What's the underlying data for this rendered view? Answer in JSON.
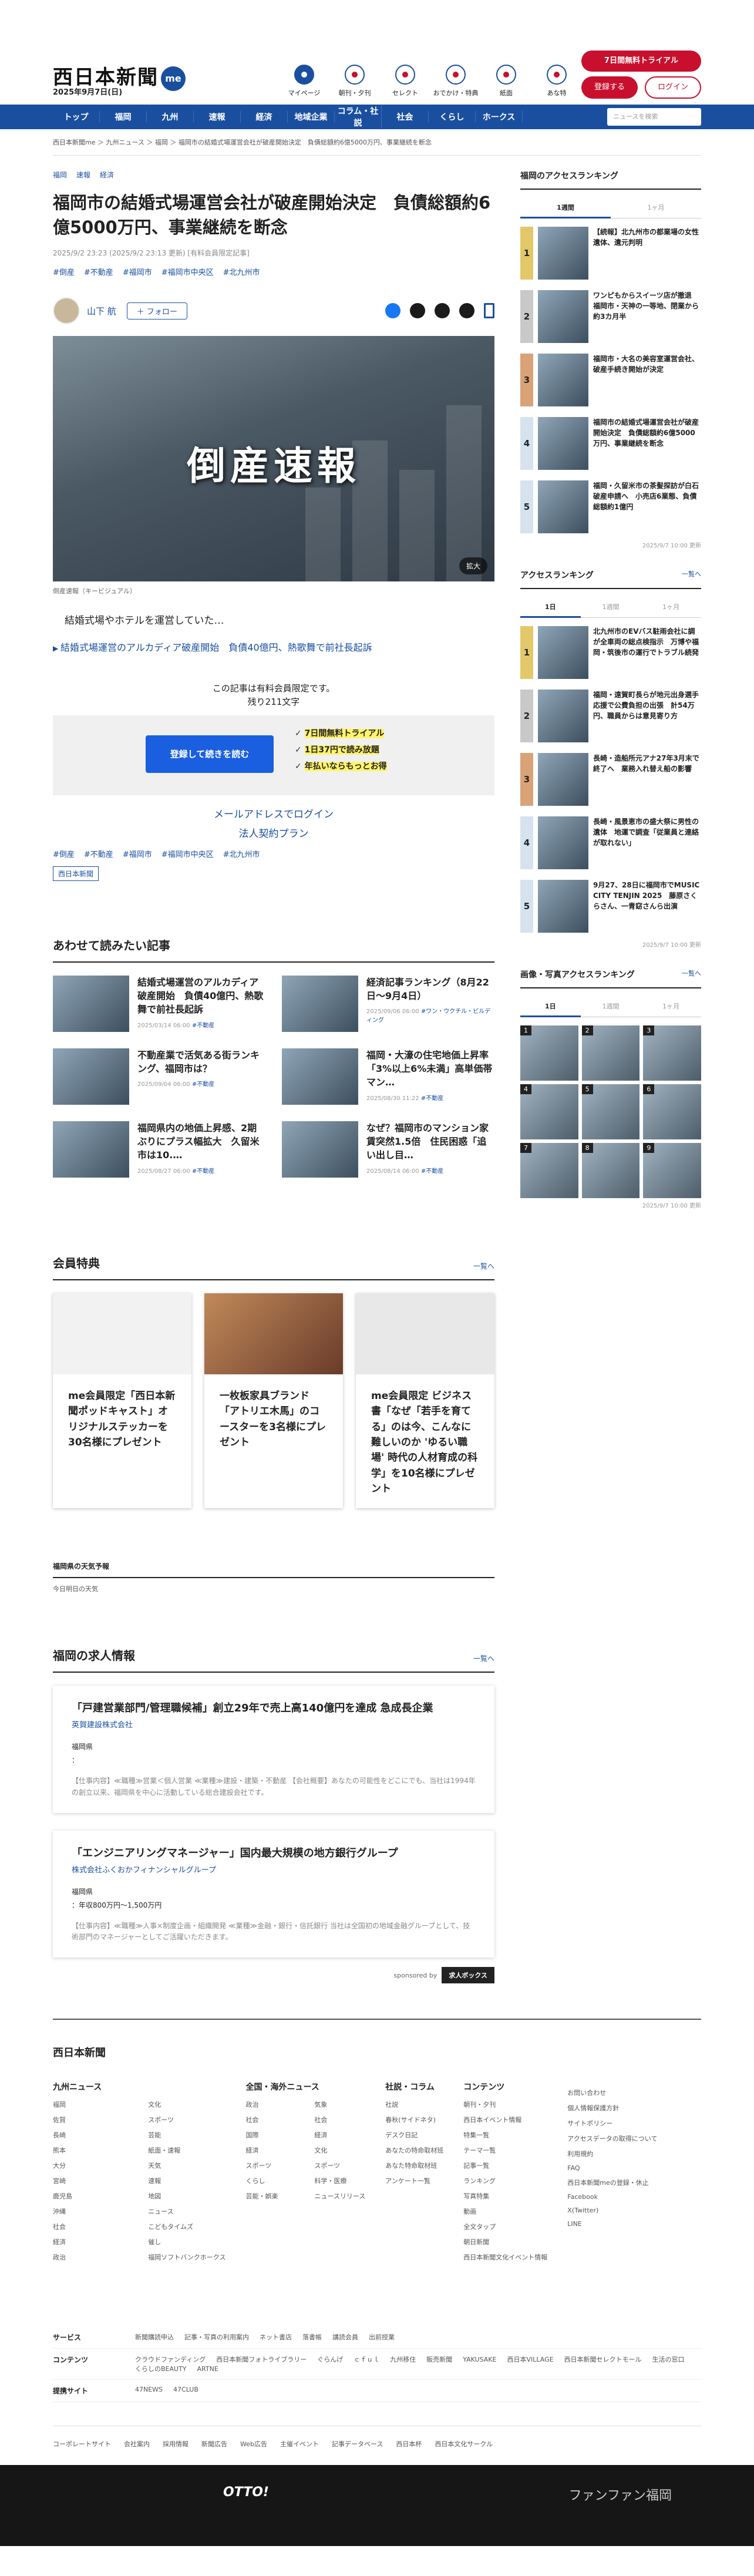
{
  "header": {
    "logo": "西日本新聞",
    "me": "me",
    "date": "2025年9月7日(日)",
    "trial": "7日間無料トライアル",
    "register": "登録する",
    "login": "ログイン",
    "icons": [
      "マイページ",
      "朝刊・夕刊",
      "セレクト",
      "おでかけ・特典",
      "紙面",
      "あな特"
    ],
    "nav": [
      "トップ",
      "福岡",
      "九州",
      "速報",
      "経済",
      "地域企業",
      "コラム・社説",
      "社会",
      "くらし",
      "ホークス"
    ],
    "nav_search": "ニュースを検索"
  },
  "breadcrumb": "西日本新聞me ＞ 九州ニュース ＞ 福岡 ＞ 福岡市の結婚式場運営会社が破産開始決定　負債総額約6億5000万円、事業継続を断念",
  "article": {
    "cats": [
      "福岡",
      "速報",
      "経済"
    ],
    "title": "福岡市の結婚式場運営会社が破産開始決定　負債総額約6億5000万円、事業継続を断念",
    "date": "2025/9/2 23:23 (2025/9/2 23:13 更新) [有料会員限定記事]",
    "tags": [
      "#倒産",
      "#不動産",
      "#福岡市",
      "#福岡市中央区",
      "#北九州市"
    ],
    "author": "山下 航",
    "follow": "＋ フォロー",
    "hero_text": "倒産速報",
    "zoom": "拡大",
    "caption": "倒産速報（キービジュアル）",
    "lead": "結婚式場やホテルを運営していた…",
    "related": "結婚式場運営のアルカディア破産開始　負債40億円、熱歌舞で前社長起訴",
    "pay_note": "この記事は有料会員限定です。",
    "remaining": "残り211文字",
    "cta": "登録して続きを読む",
    "perks": [
      "7日間無料トライアル",
      "1日37円で読み放題",
      "年払いならもっとお得"
    ],
    "mail_login": "メールアドレスでログイン",
    "corp": "法人契約プラン",
    "source": "西日本新聞"
  },
  "related": {
    "title": "あわせて読みたい記事",
    "items": [
      {
        "title": "結婚式場運営のアルカディア破産開始　負債40億円、熱歌舞で前社長起訴",
        "meta": "2025/03/14 06:00",
        "tag": "#不動産"
      },
      {
        "title": "経済記事ランキング（8月22日〜9月4日）",
        "meta": "2025/09/06 06:00",
        "tag": "#ワン・ウクチル・ビルディング"
      },
      {
        "title": "不動産業で活気ある街ランキング、福岡市は？",
        "meta": "2025/09/04 06:00",
        "tag": "#不動産"
      },
      {
        "title": "福岡・大濠の住宅地価上昇率「3%以上6%未満」高単価帯マン…",
        "meta": "2025/08/30 11:22",
        "tag": "#不動産"
      },
      {
        "title": "福岡県内の地価上昇感、2期ぶりにプラス幅拡大　久留米市は10.…",
        "meta": "2025/08/27 06:00",
        "tag": "#不動産"
      },
      {
        "title": "なぜ？福岡市のマンション家賃突然1.5倍　住民困惑「追い出し目…",
        "meta": "2025/08/14 06:00",
        "tag": "#不動産"
      }
    ]
  },
  "benefits": {
    "title": "会員特典",
    "more": "一覧へ",
    "items": [
      "me会員限定「西日本新聞ポッドキャスト」オリジナルステッカーを30名様にプレゼント",
      "一枚板家具ブランド「アトリエ木馬」のコースターを3名様にプレゼント",
      "me会員限定 ビジネス書「なぜ「若手を育てる」のは今、こんなに難しいのか 'ゆるい職場' 時代の人材育成の科学」を10名様にプレゼント"
    ]
  },
  "weather": {
    "title": "福岡県の天気予報",
    "link": "今日明日の天気"
  },
  "jobs": {
    "title": "福岡の求人情報",
    "more": "一覧へ",
    "items": [
      {
        "title": "「戸建営業部門/管理職候補」創立29年で売上高140億円を達成 急成長企業",
        "company": "英賀建設株式会社",
        "loc": "福岡県",
        "salary": "：",
        "desc": "【仕事内容】≪職種≫営業＜個人営業 ≪業種≫建設・建築・不動産 【会社概要】あなたの可能性をどこにでも、当社は1994年の創立以来、福岡県を中心に活動している総合建設会社です。"
      },
      {
        "title": "「エンジニアリングマネージャー」国内最大規模の地方銀行グループ",
        "company": "株式会社ふくおかフィナンシャルグループ",
        "loc": "福岡県",
        "salary": "：年収800万円～1,500万円",
        "desc": "【仕事内容】≪職種≫人事×制度企画・組織開発 ≪業種≫金融・銀行・信託銀行 当社は全国初の地域金融グループとして、技術部門のマネージャーとしてご活躍いただきます。"
      }
    ],
    "sponsored": "sponsored by",
    "sponsor": "求人ボックス"
  },
  "side": {
    "access_title": "福岡のアクセスランキング",
    "tabs1": [
      "1週間",
      "1ヶ月"
    ],
    "rank1": [
      "【続報】北九州市の都業場の女性遺体、遺元判明",
      "ワンピもからスイーツ店が撤退　福岡市・天神の一等地、閉業から約3カ月半",
      "福岡市・大名の美容室運営会社、破産手続き開始が決定",
      "福岡市の結婚式場運営会社が破産開始決定　負債総額約6億5000万円、事業継続を断念",
      "福岡・久留米市の茶髪探訪が白石破産申請へ　小売店6業態、負債総額約1億円"
    ],
    "upd1": "2025/9/7 10:00 更新",
    "access2_title": "アクセスランキング",
    "more": "一覧へ",
    "tabs2": [
      "1日",
      "1週間",
      "1ヶ月"
    ],
    "rank2": [
      "北九州市のEVバス駐雨会社に調が全車両の総点検指示　万博や福岡・筑後市の運行でトラブル続発",
      "福岡・遠賀町長らが地元出身選手応援で公費負担の出張　計54万円、職員からは意見寄り方",
      "長崎・造船所元アナ27年3月末で終了へ　業務入れ替え船の影響",
      "長崎・風景恵市の盛大祭に男性の遺体　地運で調査「従業員と連絡が取れない」",
      "9月27、28日に福岡市でMUSIC CITY TENJIN 2025　藤原さくらさん、一青窈さんら出演"
    ],
    "upd2": "2025/9/7 10:00 更新",
    "photo_title": "画像・写真アクセスランキング",
    "tabs3": [
      "1日",
      "1週間",
      "1ヶ月"
    ],
    "photo_nums": [
      "1",
      "2",
      "3",
      "4",
      "5",
      "6",
      "7",
      "8",
      "9"
    ],
    "upd3": "2025/9/7 10:00 更新"
  },
  "footer": {
    "logo": "西日本新聞",
    "cols": [
      {
        "title": "九州ニュース",
        "items": [
          "福岡",
          "佐賀",
          "長崎",
          "熊本",
          "大分",
          "宮崎",
          "鹿児島",
          "沖縄",
          "社会",
          "経済",
          "政治",
          "文化",
          "スポーツ",
          "芸能",
          "紙面・速報",
          "天気",
          "速報",
          "地図",
          "ニュース",
          "こどもタイムズ",
          "催し",
          "福岡ソフトバンクホークス"
        ]
      },
      {
        "title": "全国・海外ニュース",
        "items": [
          "政治",
          "社会",
          "国際",
          "経済",
          "スポーツ",
          "くらし",
          "芸能・娯楽",
          "気象",
          "社会",
          "経済",
          "文化",
          "スポーツ",
          "科学・医療",
          "ニュースリリース"
        ]
      },
      {
        "title": "社説・コラム",
        "items": [
          "社説",
          "春秋(サイドネタ)",
          "デスク日記",
          "あなたの特命取材班",
          "あなた特命取材班",
          "アンケート一覧"
        ]
      },
      {
        "title": "コンテンツ",
        "items": [
          "朝刊・夕刊",
          "西日本イベント情報",
          "特集一覧",
          "テーマ一覧",
          "記事一覧",
          "ランキング",
          "写真特集",
          "動画",
          "全文タップ",
          "朝日新聞",
          "西日本新聞文化イベント情報"
        ]
      },
      {
        "title": "",
        "items": [
          "お問い合わせ",
          "個人情報保護方針",
          "サイトポリシー",
          "アクセスデータの取得について",
          "利用規約",
          "FAQ",
          "西日本新聞meの登録・休止",
          "Facebook",
          "X(Twitter)",
          "LINE"
        ]
      }
    ],
    "rows": [
      {
        "label": "サービス",
        "items": [
          "新聞購読申込",
          "記事・写真の利用案内",
          "ネット書店",
          "落書帳",
          "講読会員",
          "出前授業"
        ]
      },
      {
        "label": "コンテンツ",
        "items": [
          "クラウドファンディング",
          "西日本新聞フォトライブラリー",
          "ぐらんげ",
          "ｃｆｕｌ",
          "九州移住",
          "販売新聞",
          "YAKUSAKE",
          "西日本VILLAGE",
          "西日本新聞セレクトモール",
          "生活の窓口",
          "くらしのBEAUTY",
          "ARTNE"
        ]
      },
      {
        "label": "提携サイト",
        "items": [
          "47NEWS",
          "47CLUB"
        ]
      }
    ],
    "bottom": [
      "コーポレートサイト",
      "会社案内",
      "採用情報",
      "新聞広告",
      "Web広告",
      "主催イベント",
      "記事データベース",
      "西日本杯",
      "西日本文化サークル"
    ],
    "band1": "OTTO!",
    "band2": "ファンファン福岡"
  }
}
